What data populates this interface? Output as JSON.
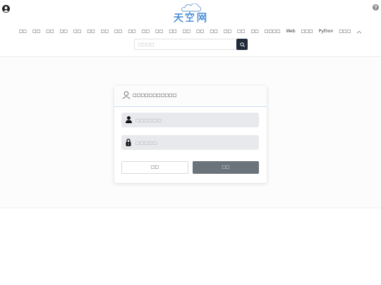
{
  "header": {
    "logo_text": "天空网",
    "nav": [
      "□□",
      "□□",
      "□□",
      "□□",
      "□□",
      "□□",
      "□□",
      "□□",
      "□□",
      "□□",
      "□□",
      "□□",
      "□□",
      "□□",
      "□□",
      "□□",
      "□□",
      "□□",
      "□□□□",
      "Web",
      "□□□",
      "Python",
      "□□□"
    ],
    "search": {
      "placeholder": "□□□□"
    }
  },
  "login": {
    "title": "□□□□□□□□□□□",
    "username_placeholder": "□□□□□□",
    "password_placeholder": "□□□□□",
    "left_button": "□□",
    "right_button": "□□"
  },
  "icons": {
    "top_left": "user-circle-icon",
    "top_right": "help-icon",
    "nav_toggle": "chevron-up-icon",
    "search": "search-icon",
    "login_header": "user-outline-icon",
    "username_field": "user-icon",
    "password_field": "lock-icon"
  },
  "colors": {
    "logo": "#3d86d4",
    "search_button": "#1f2b3a",
    "login_button": "#6b737b",
    "field_background": "#e8e9ec",
    "card_header_border": "#c9def2"
  }
}
